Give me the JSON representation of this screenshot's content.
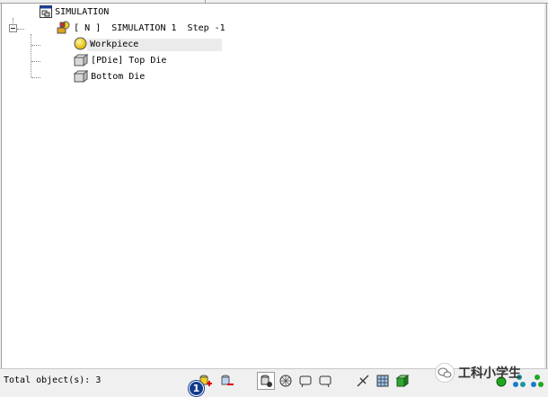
{
  "tree": {
    "root": {
      "label": "SIMULATION",
      "icon": "simulation-window-icon"
    },
    "simulation": {
      "label": "[ N ]  SIMULATION 1  Step -1",
      "icon": "simulation-objects-icon"
    },
    "objects": [
      {
        "label": "Workpiece",
        "icon": "workpiece-sphere-icon",
        "selected": true
      },
      {
        "label": "[PDie] Top Die",
        "icon": "top-die-block-icon",
        "selected": false
      },
      {
        "label": "Bottom Die",
        "icon": "bottom-die-block-icon",
        "selected": false
      }
    ]
  },
  "statusbar": {
    "total_objects": "Total object(s): 3",
    "callout_number": "1",
    "watermark": "工科小学生",
    "tools": [
      "add-object-icon",
      "delete-object-icon",
      "object-mode-icon",
      "mesh-icon",
      "view-icon",
      "display-icon",
      "inter-object-icon",
      "geometry-icon",
      "material-icon",
      "green-node-icon",
      "tree-nodes-icon",
      "hierarchy-icon"
    ]
  },
  "colors": {
    "selection": "#ebebeb",
    "callout": "#123b8c",
    "workpiece": "#f2d21a"
  }
}
